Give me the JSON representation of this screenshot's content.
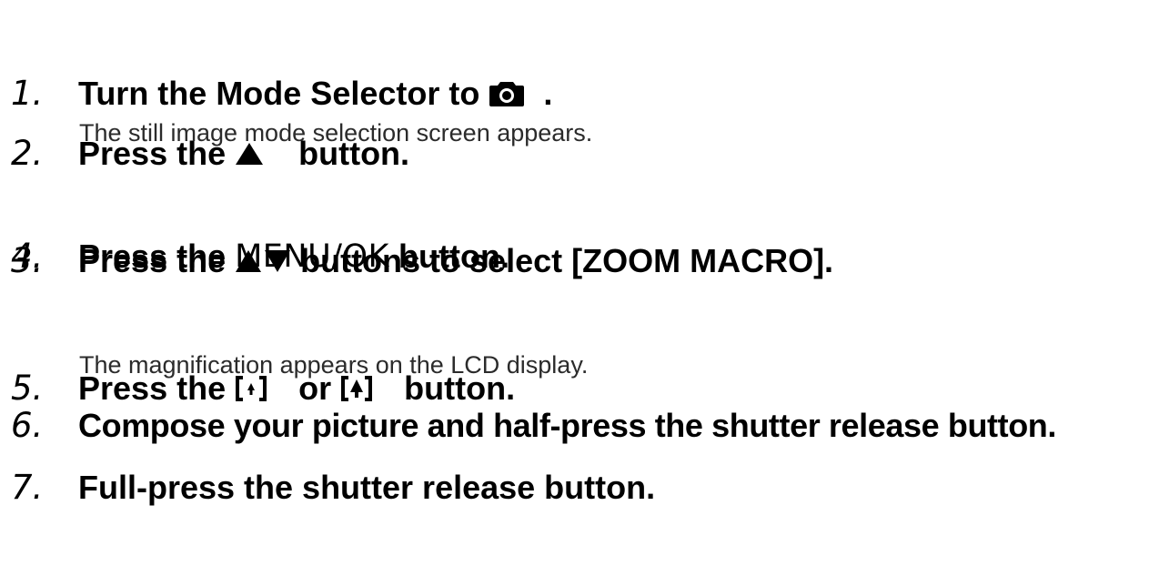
{
  "steps": [
    {
      "number": "1.",
      "before": "Turn the Mode Selector to ",
      "icon": "camera-icon",
      "after": "."
    },
    {
      "number": "2.",
      "before": "Press the ",
      "icon": "up-triangle-icon",
      "after": " button.",
      "note": "The still image mode selection screen appears."
    },
    {
      "number": "3.",
      "before": "Press the ",
      "icon": "up-down-triangle-icon",
      "after": " buttons to select [ZOOM MACRO]."
    },
    {
      "number": "4.",
      "before": "Press the ",
      "button_label": "MENU/OK",
      "after": " button."
    },
    {
      "number": "5.",
      "before": "Press the ",
      "icon1": "zoom-out-wide-icon",
      "middle": " or ",
      "icon2": "zoom-in-tele-icon",
      "after": " button.",
      "note": "The magnification appears on the LCD display."
    },
    {
      "number": "6.",
      "text": "Compose your picture and half-press the shutter release button."
    },
    {
      "number": "7.",
      "text": "Full-press the shutter release button."
    }
  ]
}
